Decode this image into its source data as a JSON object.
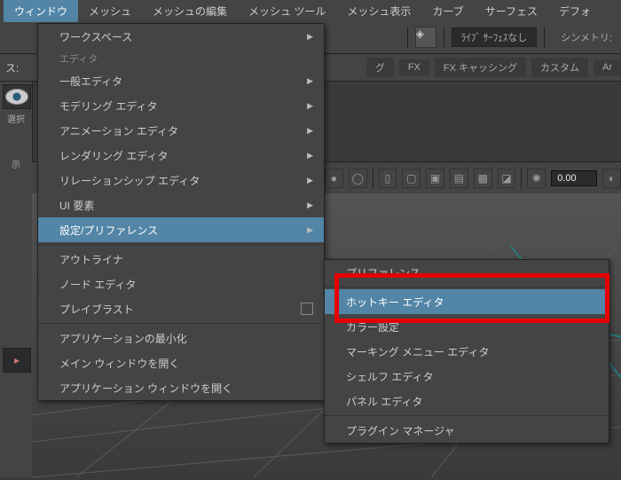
{
  "menubar": {
    "items": [
      "ウィンドウ",
      "メッシュ",
      "メッシュの編集",
      "メッシュ ツール",
      "メッシュ表示",
      "カーブ",
      "サーフェス",
      "デフォ"
    ],
    "active_index": 0
  },
  "toolbar": {
    "live_label": "ﾗｲﾌﾞ ｻｰﾌｪｽなし",
    "sym_label": "シンメトリ:"
  },
  "shelf": {
    "leading": "ス:",
    "tabs": [
      "グ",
      "FX",
      "FX キャッシング",
      "カスタム",
      "Ar"
    ]
  },
  "sideleft": {
    "label": "選択",
    "disp": "示"
  },
  "numfield": {
    "value": "0.00"
  },
  "dropdown": {
    "workspace": "ワークスペース",
    "editors_header": "エディタ",
    "general": "一般エディタ",
    "modeling": "モデリング エディタ",
    "animation": "アニメーション エディタ",
    "rendering": "レンダリング エディタ",
    "relationship": "リレーションシップ エディタ",
    "ui": "UI 要素",
    "settings": "設定/プリファレンス",
    "outliner": "アウトライナ",
    "node": "ノード エディタ",
    "playblast": "プレイブラスト",
    "minimize": "アプリケーションの最小化",
    "mainwin": "メイン ウィンドウを開く",
    "appwin": "アプリケーション ウィンドウを開く"
  },
  "submenu": {
    "prefs": "プリファレンス",
    "hotkey": "ホットキー エディタ",
    "color": "カラー設定",
    "marking": "マーキング メニュー エディタ",
    "shelf": "シェルフ エディタ",
    "panel": "パネル エディタ",
    "plugin": "プラグイン マネージャ"
  }
}
